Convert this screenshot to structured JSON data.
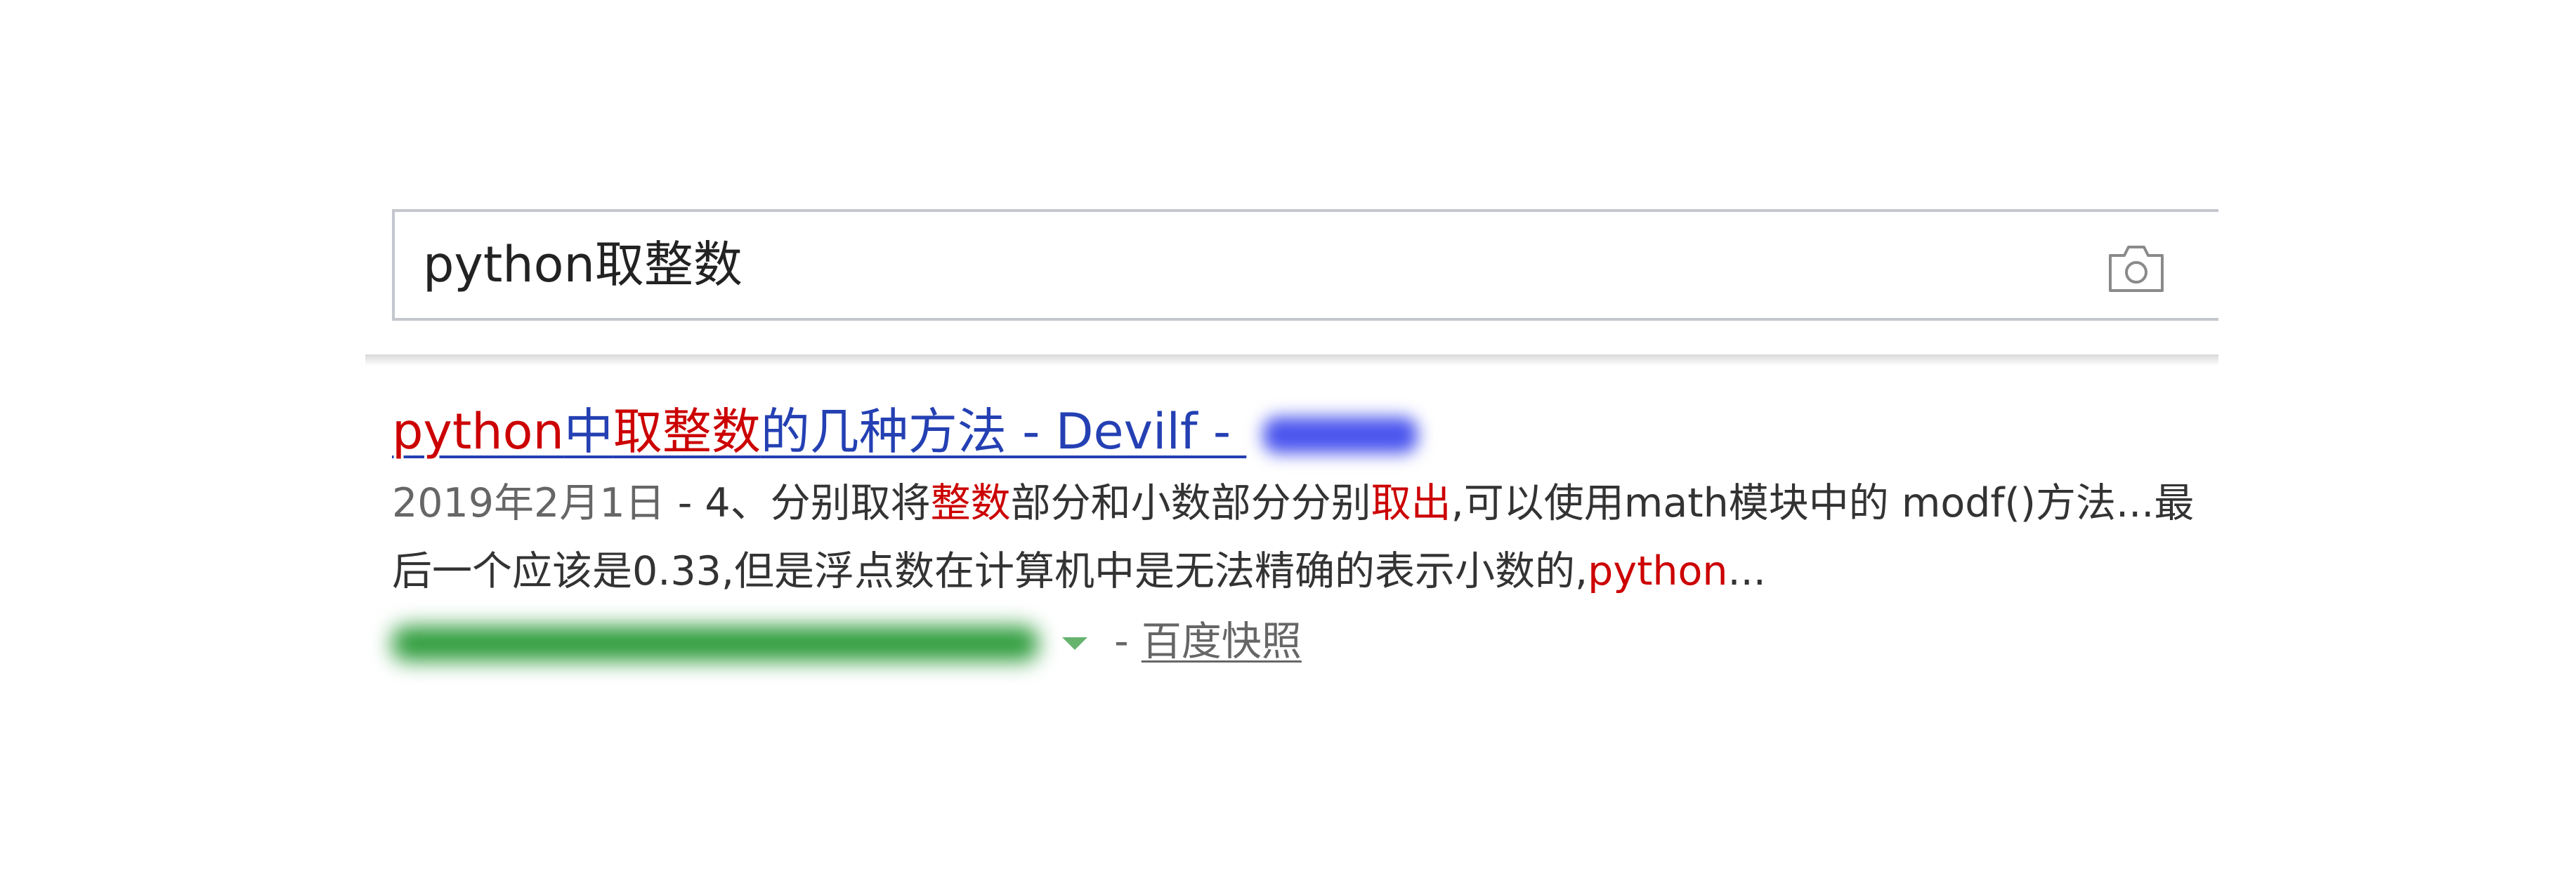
{
  "search": {
    "query": "python取整数",
    "icons": {
      "camera": "camera-icon"
    }
  },
  "result": {
    "title": {
      "part1_highlight": "python",
      "part2": "中",
      "part3_highlight": "取整数",
      "part4": "的几种方法 - Devilf - "
    },
    "date": "2019年2月1日",
    "abstract": {
      "part1": " - 4、分别取将",
      "part2_highlight": "整数",
      "part3": "部分和小数部分分别",
      "part4_highlight": "取出",
      "part5": ",可以使用math模块中的 modf()方法...最后一个应该是0.33,但是浮点数在计算机中是无法精确的表示小数的,",
      "part6_highlight": "python",
      "part7": "..."
    },
    "url_separator": " - ",
    "snapshot_label": "百度快照"
  },
  "colors": {
    "title_link": "#2440b3",
    "highlight": "#cc0000",
    "url_green": "#2e9c3c",
    "border": "#c4c7ce"
  }
}
